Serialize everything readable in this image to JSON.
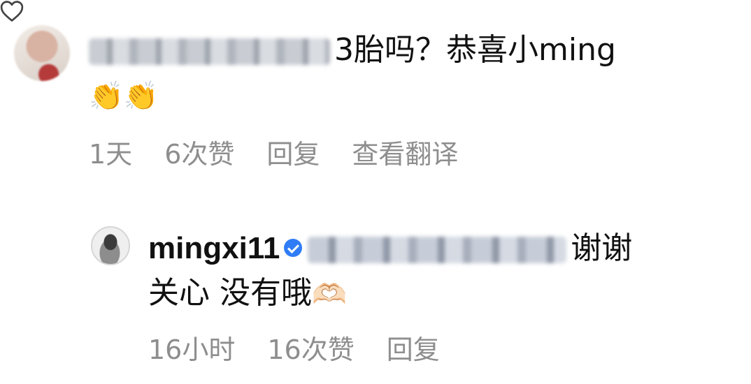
{
  "comments": [
    {
      "username": "",
      "text": "3胎吗？恭喜小ming",
      "emoji": "👏👏",
      "time": "1天",
      "likes": "6次赞",
      "reply_label": "回复",
      "translate_label": "查看翻译",
      "liked": false
    },
    {
      "username": "mingxi11",
      "verified": true,
      "mention": "",
      "text": "谢谢关心 没有哦",
      "emoji": "🫶🏻",
      "time": "16小时",
      "likes": "16次赞",
      "reply_label": "回复",
      "liked": false
    }
  ],
  "icons": {
    "like": "heart-icon",
    "verified": "verified-badge-icon"
  },
  "colors": {
    "meta_text": "#8e8e8e",
    "verified": "#2f7cf6",
    "text": "#111111"
  }
}
